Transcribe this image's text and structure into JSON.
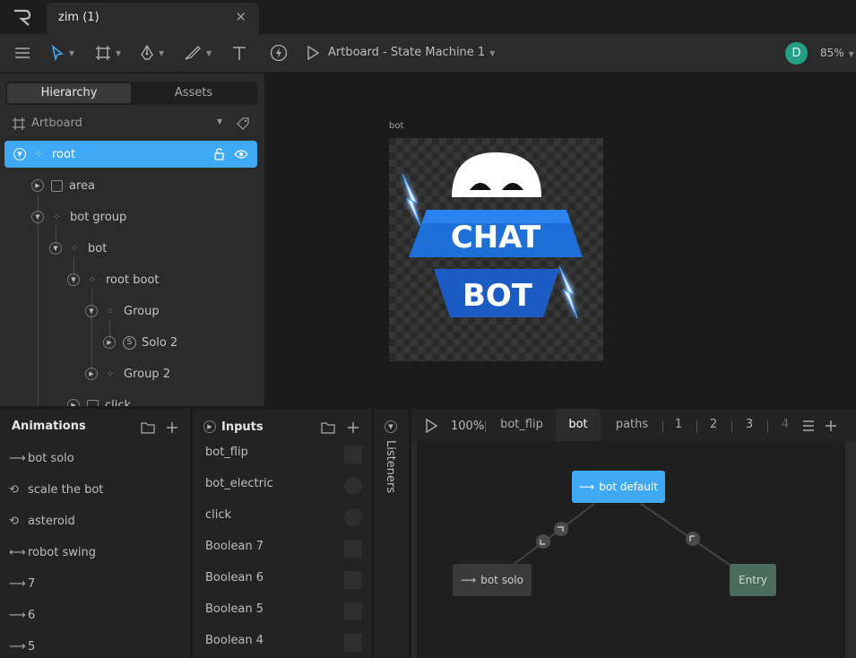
{
  "window": {
    "tab_title": "zim (1)",
    "close_glyph": "✕"
  },
  "toolbar": {
    "artboard_label": "Artboard - State Machine 1",
    "avatar_letter": "D",
    "zoom": "85%",
    "accent": "#3fa9f5"
  },
  "hierarchy": {
    "tabs": [
      "Hierarchy",
      "Assets"
    ],
    "active_tab": "Hierarchy",
    "artboard_label": "Artboard",
    "items": [
      {
        "label": "root",
        "icon": "group-icon",
        "selected": true
      },
      {
        "label": "area",
        "icon": "shape-box-icon"
      },
      {
        "label": "bot group",
        "icon": "group-icon"
      },
      {
        "label": "bot",
        "icon": "group-icon"
      },
      {
        "label": "root boot",
        "icon": "group-icon"
      },
      {
        "label": "Group",
        "icon": "group-icon"
      },
      {
        "label": "Solo 2",
        "icon": "solo-icon",
        "solo_letter": "S"
      },
      {
        "label": "Group 2",
        "icon": "group-icon"
      },
      {
        "label": "click",
        "icon": "shape-box-icon"
      }
    ]
  },
  "stage": {
    "artboard_name": "bot",
    "logo_text_1": "CHAT",
    "logo_text_2": "BOT"
  },
  "animations": {
    "title": "Animations",
    "items": [
      {
        "label": "bot solo",
        "icon": "one-shot-icon"
      },
      {
        "label": "scale the bot",
        "icon": "loop-icon"
      },
      {
        "label": "asteroid",
        "icon": "loop-icon"
      },
      {
        "label": "robot swing",
        "icon": "ping-pong-icon"
      },
      {
        "label": "7",
        "icon": "one-shot-icon"
      },
      {
        "label": "6",
        "icon": "one-shot-icon"
      },
      {
        "label": "5",
        "icon": "one-shot-icon"
      }
    ]
  },
  "inputs": {
    "title": "Inputs",
    "items": [
      {
        "label": "bot_flip",
        "kind": "boolean"
      },
      {
        "label": "bot_electric",
        "kind": "trigger"
      },
      {
        "label": "click",
        "kind": "trigger"
      },
      {
        "label": "Boolean 7",
        "kind": "boolean"
      },
      {
        "label": "Boolean 6",
        "kind": "boolean"
      },
      {
        "label": "Boolean 5",
        "kind": "boolean"
      },
      {
        "label": "Boolean 4",
        "kind": "boolean"
      }
    ]
  },
  "listeners": {
    "title": "Listeners"
  },
  "state_machine": {
    "zoom": "100%",
    "tabs": [
      "bot_flip",
      "bot",
      "paths",
      "1",
      "2",
      "3",
      "4"
    ],
    "active_tab": "bot",
    "nodes": {
      "default": "bot default",
      "solo": "bot solo",
      "entry": "Entry"
    },
    "colors": {
      "default_node": "#3fa9f5",
      "solo_node": "#3a3a3a",
      "entry_node": "#4b6b5c"
    }
  }
}
